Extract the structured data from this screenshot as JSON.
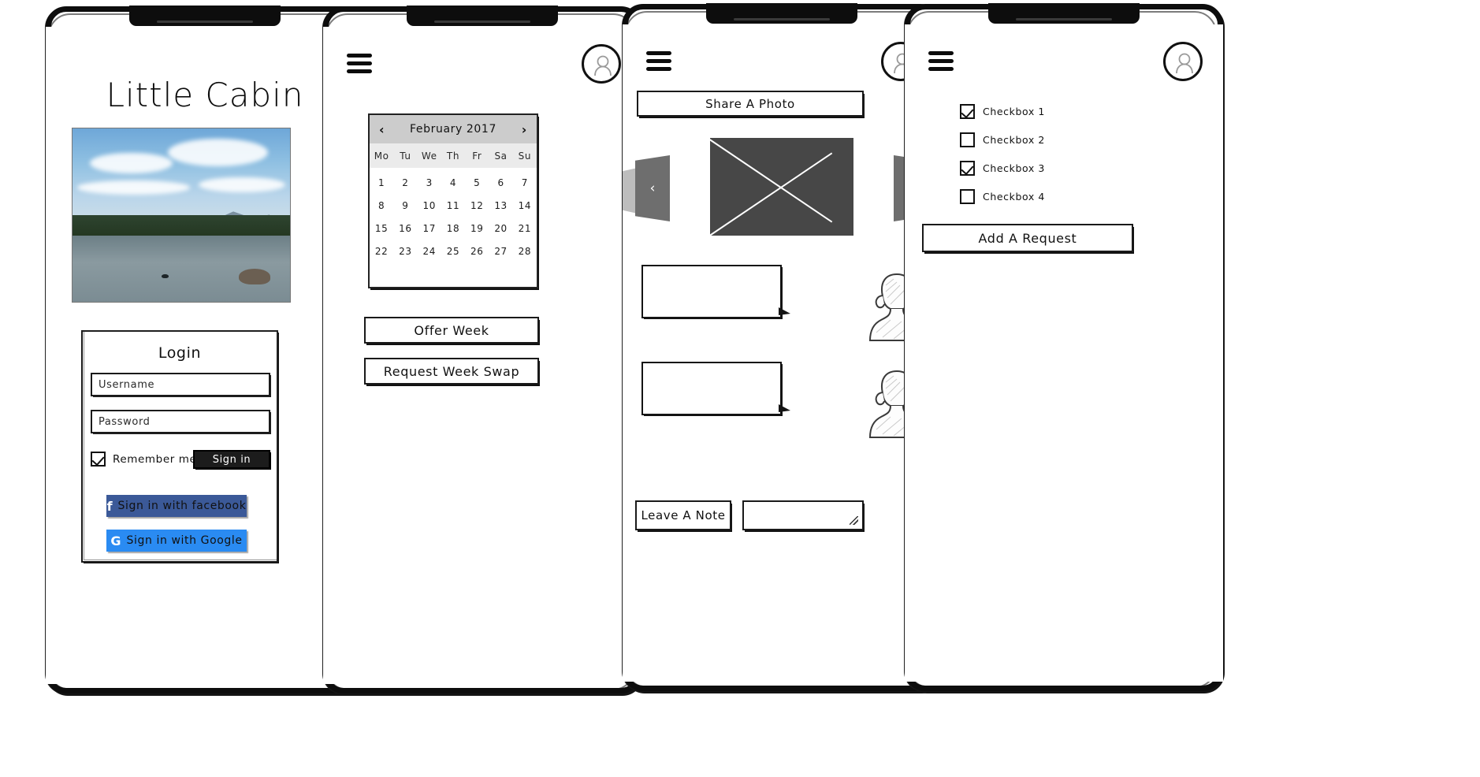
{
  "app": {
    "title": "Little Cabin",
    "frames": [
      "login-screen",
      "calendar-screen",
      "feed-screen",
      "requests-screen"
    ]
  },
  "header": {
    "menu_icon": "hamburger-menu-icon",
    "avatar_icon": "user-avatar-icon"
  },
  "login": {
    "title": "Little Cabin",
    "photo_alt": "lake-photo",
    "card_title": "Login",
    "username_placeholder": "Username",
    "password_placeholder": "Password",
    "username_value": "",
    "password_value": "",
    "remember_label": "Remember me",
    "remember_checked": true,
    "signin_label": "Sign in",
    "facebook_label": "Sign in with facebook",
    "facebook_glyph": "f",
    "facebook_color": "#3b5998",
    "google_label": "Sign in with Google",
    "google_glyph": "G",
    "google_color": "#2a8bf2"
  },
  "calendar": {
    "month_label": "February 2017",
    "prev_glyph": "‹",
    "next_glyph": "›",
    "header_bg": "#cccccc",
    "dow_bg": "#ebebeb",
    "weekdays": [
      "Mo",
      "Tu",
      "We",
      "Th",
      "Fr",
      "Sa",
      "Su"
    ],
    "days": [
      [
        "1",
        "2",
        "3",
        "4",
        "5",
        "6",
        "7"
      ],
      [
        "8",
        "9",
        "10",
        "11",
        "12",
        "13",
        "14"
      ],
      [
        "15",
        "16",
        "17",
        "18",
        "19",
        "20",
        "21"
      ],
      [
        "22",
        "23",
        "24",
        "25",
        "26",
        "27",
        "28"
      ]
    ],
    "offer_week_label": "Offer Week",
    "request_swap_label": "Request Week Swap"
  },
  "feed": {
    "share_photo_label": "Share A Photo",
    "carousel": {
      "prev_glyph": "‹",
      "next_glyph": "›",
      "main_color": "#474747",
      "side_color": "#6e6e6e",
      "far_color": "#bdbdbd",
      "placeholder": "image-placeholder-cross"
    },
    "messages": [
      {
        "text": "",
        "author_icon": "person-bust-icon"
      },
      {
        "text": "",
        "author_icon": "person-bust-icon"
      }
    ],
    "leave_note_label": "Leave A Note",
    "note_value": "",
    "note_placeholder": ""
  },
  "requests": {
    "checkboxes": [
      {
        "label": "Checkbox 1",
        "checked": true
      },
      {
        "label": "Checkbox 2",
        "checked": false
      },
      {
        "label": "Checkbox 3",
        "checked": true
      },
      {
        "label": "Checkbox 4",
        "checked": false
      }
    ],
    "add_request_label": "Add A Request"
  }
}
